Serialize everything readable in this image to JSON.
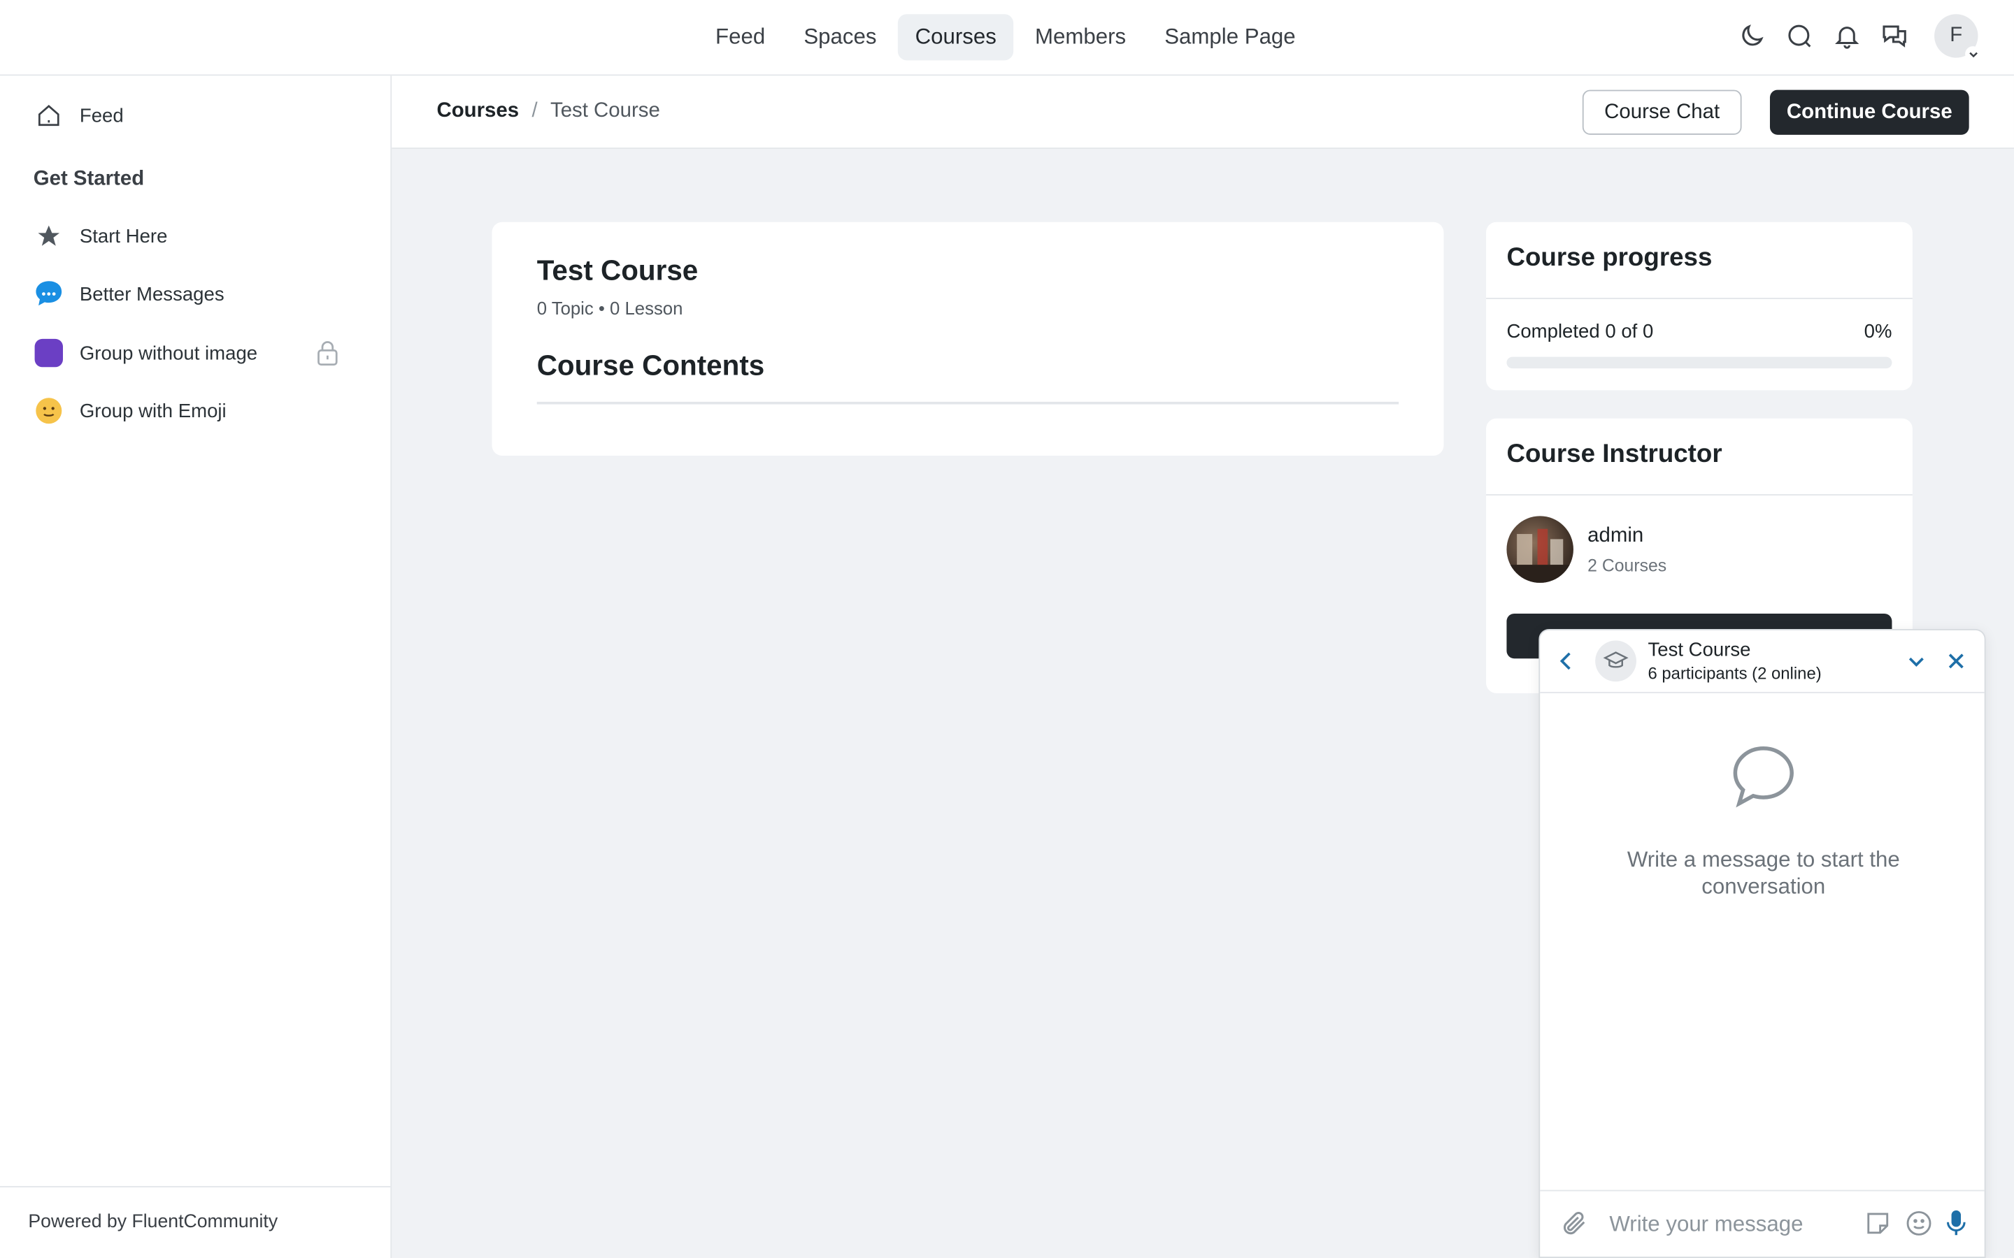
{
  "topnav": {
    "items": [
      {
        "label": "Feed",
        "active": false
      },
      {
        "label": "Spaces",
        "active": false
      },
      {
        "label": "Courses",
        "active": true
      },
      {
        "label": "Members",
        "active": false
      },
      {
        "label": "Sample Page",
        "active": false
      }
    ],
    "avatar_initial": "F",
    "icons": [
      "moon-icon",
      "search-icon",
      "bell-icon",
      "chat-bubbles-icon"
    ]
  },
  "sidebar": {
    "feed_label": "Feed",
    "group_heading": "Get Started",
    "items": [
      {
        "label": "Start Here",
        "icon": "star-icon"
      },
      {
        "label": "Better Messages",
        "icon": "chat-bubble-icon"
      },
      {
        "label": "Group without image",
        "icon": "purple-square-icon",
        "locked": true
      },
      {
        "label": "Group with Emoji",
        "icon": "smile-emoji-icon"
      }
    ],
    "footer": "Powered by FluentCommunity"
  },
  "subheader": {
    "breadcrumb_root": "Courses",
    "breadcrumb_sep": "/",
    "breadcrumb_current": "Test Course",
    "course_chat_label": "Course Chat",
    "continue_label": "Continue Course"
  },
  "course": {
    "title": "Test Course",
    "meta": "0 Topic • 0 Lesson",
    "contents_heading": "Course Contents"
  },
  "progress": {
    "heading": "Course progress",
    "completed_text": "Completed 0 of 0",
    "percent_text": "0%",
    "fraction": 0
  },
  "instructor": {
    "heading": "Course Instructor",
    "name": "admin",
    "courses": "2 Courses"
  },
  "chat": {
    "title": "Test Course",
    "subtitle": "6 participants (2 online)",
    "empty_text": "Write a message to start the conversation",
    "input_placeholder": "Write your message"
  },
  "colors": {
    "accent_dark": "#23282d",
    "chat_accent": "#1e6fa8",
    "purple_group": "#6b3fc4"
  }
}
